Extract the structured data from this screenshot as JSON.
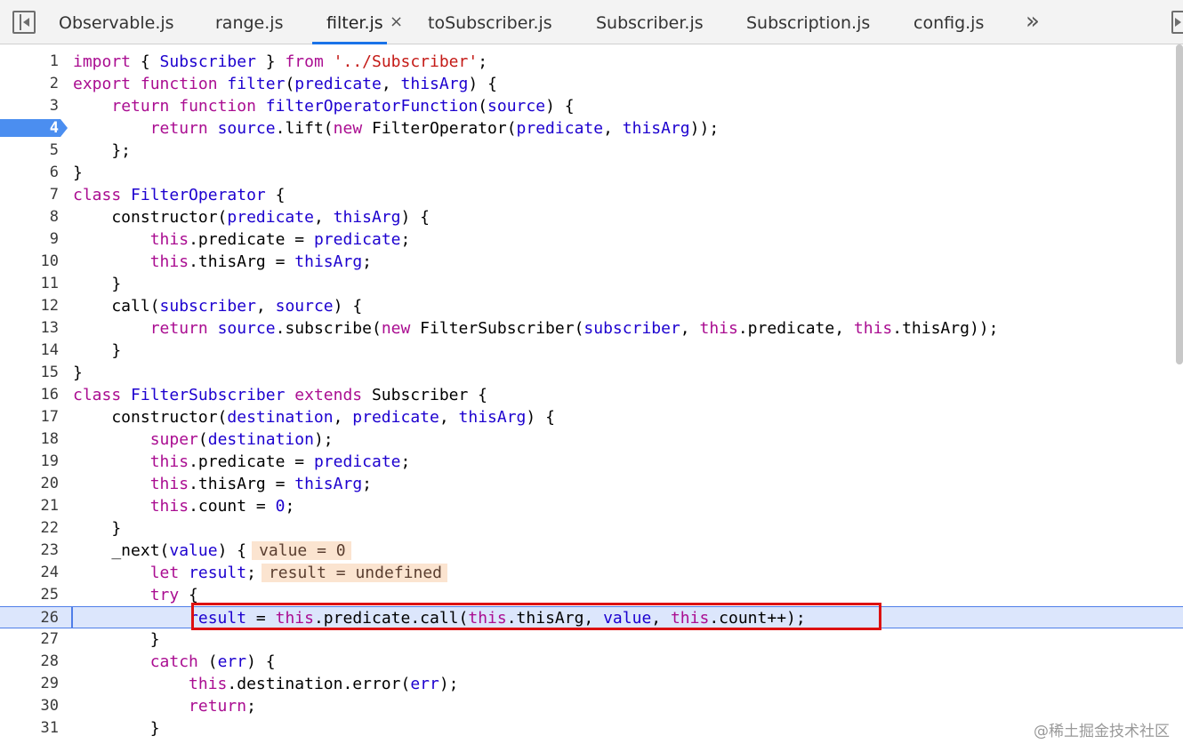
{
  "tabbar": {
    "nav_left_icon": "sidebar-toggle-left-icon",
    "nav_right_icon": "sidebar-toggle-right-icon",
    "more_glyph": "»",
    "close_glyph": "×",
    "tabs": [
      {
        "label": "Observable.js",
        "active": false
      },
      {
        "label": "range.js",
        "active": false
      },
      {
        "label": "filter.js",
        "active": true
      },
      {
        "label": "toSubscriber.js",
        "active": false
      },
      {
        "label": "Subscriber.js",
        "active": false
      },
      {
        "label": "Subscription.js",
        "active": false
      },
      {
        "label": "config.js",
        "active": false
      }
    ]
  },
  "editor": {
    "breakpoint_line": 4,
    "paused_line": 26,
    "lines": [
      {
        "n": "1",
        "tokens": [
          [
            "import",
            "kw"
          ],
          [
            " { ",
            "pl"
          ],
          [
            "Subscriber",
            "blue"
          ],
          [
            " } ",
            "pl"
          ],
          [
            "from",
            "kw"
          ],
          [
            " ",
            "pl"
          ],
          [
            "'../Subscriber'",
            "str"
          ],
          [
            ";",
            "pl"
          ]
        ]
      },
      {
        "n": "2",
        "tokens": [
          [
            "export",
            "kw"
          ],
          [
            " ",
            "pl"
          ],
          [
            "function",
            "kw"
          ],
          [
            " ",
            "pl"
          ],
          [
            "filter",
            "blue"
          ],
          [
            "(",
            "pl"
          ],
          [
            "predicate",
            "blue"
          ],
          [
            ", ",
            "pl"
          ],
          [
            "thisArg",
            "blue"
          ],
          [
            ") {",
            "pl"
          ]
        ]
      },
      {
        "n": "3",
        "tokens": [
          [
            "    ",
            "pl"
          ],
          [
            "return",
            "kw"
          ],
          [
            " ",
            "pl"
          ],
          [
            "function",
            "kw"
          ],
          [
            " ",
            "pl"
          ],
          [
            "filterOperatorFunction",
            "blue"
          ],
          [
            "(",
            "pl"
          ],
          [
            "source",
            "blue"
          ],
          [
            ") {",
            "pl"
          ]
        ]
      },
      {
        "n": "4",
        "tokens": [
          [
            "        ",
            "pl"
          ],
          [
            "return",
            "kw"
          ],
          [
            " ",
            "pl"
          ],
          [
            "source",
            "blue"
          ],
          [
            ".lift(",
            "pl"
          ],
          [
            "new",
            "kw"
          ],
          [
            " FilterOperator(",
            "pl"
          ],
          [
            "predicate",
            "blue"
          ],
          [
            ", ",
            "pl"
          ],
          [
            "thisArg",
            "blue"
          ],
          [
            "));",
            "pl"
          ]
        ]
      },
      {
        "n": "5",
        "tokens": [
          [
            "    };",
            "pl"
          ]
        ]
      },
      {
        "n": "6",
        "tokens": [
          [
            "}",
            "pl"
          ]
        ]
      },
      {
        "n": "7",
        "tokens": [
          [
            "class",
            "kw"
          ],
          [
            " ",
            "pl"
          ],
          [
            "FilterOperator",
            "blue"
          ],
          [
            " {",
            "pl"
          ]
        ]
      },
      {
        "n": "8",
        "tokens": [
          [
            "    constructor(",
            "pl"
          ],
          [
            "predicate",
            "blue"
          ],
          [
            ", ",
            "pl"
          ],
          [
            "thisArg",
            "blue"
          ],
          [
            ") {",
            "pl"
          ]
        ]
      },
      {
        "n": "9",
        "tokens": [
          [
            "        ",
            "pl"
          ],
          [
            "this",
            "kw"
          ],
          [
            ".predicate ",
            "pl"
          ],
          [
            "=",
            "op"
          ],
          [
            " ",
            "pl"
          ],
          [
            "predicate",
            "blue"
          ],
          [
            ";",
            "pl"
          ]
        ]
      },
      {
        "n": "10",
        "tokens": [
          [
            "        ",
            "pl"
          ],
          [
            "this",
            "kw"
          ],
          [
            ".thisArg ",
            "pl"
          ],
          [
            "=",
            "op"
          ],
          [
            " ",
            "pl"
          ],
          [
            "thisArg",
            "blue"
          ],
          [
            ";",
            "pl"
          ]
        ]
      },
      {
        "n": "11",
        "tokens": [
          [
            "    }",
            "pl"
          ]
        ]
      },
      {
        "n": "12",
        "tokens": [
          [
            "    call(",
            "pl"
          ],
          [
            "subscriber",
            "blue"
          ],
          [
            ", ",
            "pl"
          ],
          [
            "source",
            "blue"
          ],
          [
            ") {",
            "pl"
          ]
        ]
      },
      {
        "n": "13",
        "tokens": [
          [
            "        ",
            "pl"
          ],
          [
            "return",
            "kw"
          ],
          [
            " ",
            "pl"
          ],
          [
            "source",
            "blue"
          ],
          [
            ".subscribe(",
            "pl"
          ],
          [
            "new",
            "kw"
          ],
          [
            " FilterSubscriber(",
            "pl"
          ],
          [
            "subscriber",
            "blue"
          ],
          [
            ", ",
            "pl"
          ],
          [
            "this",
            "kw"
          ],
          [
            ".predicate, ",
            "pl"
          ],
          [
            "this",
            "kw"
          ],
          [
            ".thisArg));",
            "pl"
          ]
        ]
      },
      {
        "n": "14",
        "tokens": [
          [
            "    }",
            "pl"
          ]
        ]
      },
      {
        "n": "15",
        "tokens": [
          [
            "}",
            "pl"
          ]
        ]
      },
      {
        "n": "16",
        "tokens": [
          [
            "class",
            "kw"
          ],
          [
            " ",
            "pl"
          ],
          [
            "FilterSubscriber",
            "blue"
          ],
          [
            " ",
            "pl"
          ],
          [
            "extends",
            "kw"
          ],
          [
            " Subscriber {",
            "pl"
          ]
        ]
      },
      {
        "n": "17",
        "tokens": [
          [
            "    constructor(",
            "pl"
          ],
          [
            "destination",
            "blue"
          ],
          [
            ", ",
            "pl"
          ],
          [
            "predicate",
            "blue"
          ],
          [
            ", ",
            "pl"
          ],
          [
            "thisArg",
            "blue"
          ],
          [
            ") {",
            "pl"
          ]
        ]
      },
      {
        "n": "18",
        "tokens": [
          [
            "        ",
            "pl"
          ],
          [
            "super",
            "kw"
          ],
          [
            "(",
            "pl"
          ],
          [
            "destination",
            "blue"
          ],
          [
            ");",
            "pl"
          ]
        ]
      },
      {
        "n": "19",
        "tokens": [
          [
            "        ",
            "pl"
          ],
          [
            "this",
            "kw"
          ],
          [
            ".predicate ",
            "pl"
          ],
          [
            "=",
            "op"
          ],
          [
            " ",
            "pl"
          ],
          [
            "predicate",
            "blue"
          ],
          [
            ";",
            "pl"
          ]
        ]
      },
      {
        "n": "20",
        "tokens": [
          [
            "        ",
            "pl"
          ],
          [
            "this",
            "kw"
          ],
          [
            ".thisArg ",
            "pl"
          ],
          [
            "=",
            "op"
          ],
          [
            " ",
            "pl"
          ],
          [
            "thisArg",
            "blue"
          ],
          [
            ";",
            "pl"
          ]
        ]
      },
      {
        "n": "21",
        "tokens": [
          [
            "        ",
            "pl"
          ],
          [
            "this",
            "kw"
          ],
          [
            ".count ",
            "pl"
          ],
          [
            "=",
            "op"
          ],
          [
            " ",
            "pl"
          ],
          [
            "0",
            "num"
          ],
          [
            ";",
            "pl"
          ]
        ]
      },
      {
        "n": "22",
        "tokens": [
          [
            "    }",
            "pl"
          ]
        ]
      },
      {
        "n": "23",
        "tokens": [
          [
            "    _next(",
            "pl"
          ],
          [
            "value",
            "blue"
          ],
          [
            ") {",
            "pl"
          ]
        ],
        "hint": "value = 0"
      },
      {
        "n": "24",
        "tokens": [
          [
            "        ",
            "pl"
          ],
          [
            "let",
            "kw"
          ],
          [
            " ",
            "pl"
          ],
          [
            "result",
            "blue"
          ],
          [
            ";",
            "pl"
          ]
        ],
        "hint": "result = undefined"
      },
      {
        "n": "25",
        "tokens": [
          [
            "        ",
            "pl"
          ],
          [
            "try",
            "kw"
          ],
          [
            " {",
            "pl"
          ]
        ]
      },
      {
        "n": "26",
        "tokens": [
          [
            "            ",
            "pl"
          ],
          [
            "result",
            "blue"
          ],
          [
            " ",
            "pl"
          ],
          [
            "=",
            "op"
          ],
          [
            " ",
            "pl"
          ],
          [
            "this",
            "kw"
          ],
          [
            ".predicate.call(",
            "pl"
          ],
          [
            "this",
            "kw"
          ],
          [
            ".thisArg, ",
            "pl"
          ],
          [
            "value",
            "blue"
          ],
          [
            ", ",
            "pl"
          ],
          [
            "this",
            "kw"
          ],
          [
            ".count",
            "pl"
          ],
          [
            "++",
            "op"
          ],
          [
            ");",
            "pl"
          ]
        ]
      },
      {
        "n": "27",
        "tokens": [
          [
            "        }",
            "pl"
          ]
        ]
      },
      {
        "n": "28",
        "tokens": [
          [
            "        ",
            "pl"
          ],
          [
            "catch",
            "kw"
          ],
          [
            " (",
            "pl"
          ],
          [
            "err",
            "blue"
          ],
          [
            ") {",
            "pl"
          ]
        ]
      },
      {
        "n": "29",
        "tokens": [
          [
            "            ",
            "pl"
          ],
          [
            "this",
            "kw"
          ],
          [
            ".destination.error(",
            "pl"
          ],
          [
            "err",
            "blue"
          ],
          [
            ");",
            "pl"
          ]
        ]
      },
      {
        "n": "30",
        "tokens": [
          [
            "            ",
            "pl"
          ],
          [
            "return",
            "kw"
          ],
          [
            ";",
            "pl"
          ]
        ]
      },
      {
        "n": "31",
        "tokens": [
          [
            "        }",
            "pl"
          ]
        ]
      }
    ]
  },
  "colors": {
    "keyword": "#aa0d91",
    "identifier": "#1c00cf",
    "string": "#c41a16",
    "breakpoint": "#4b8ef0",
    "exec_line_bg": "#dce6fc",
    "highlight_box": "#dd1111",
    "inline_value_bg": "#fbe4d0"
  },
  "watermark": "@稀土掘金技术社区"
}
